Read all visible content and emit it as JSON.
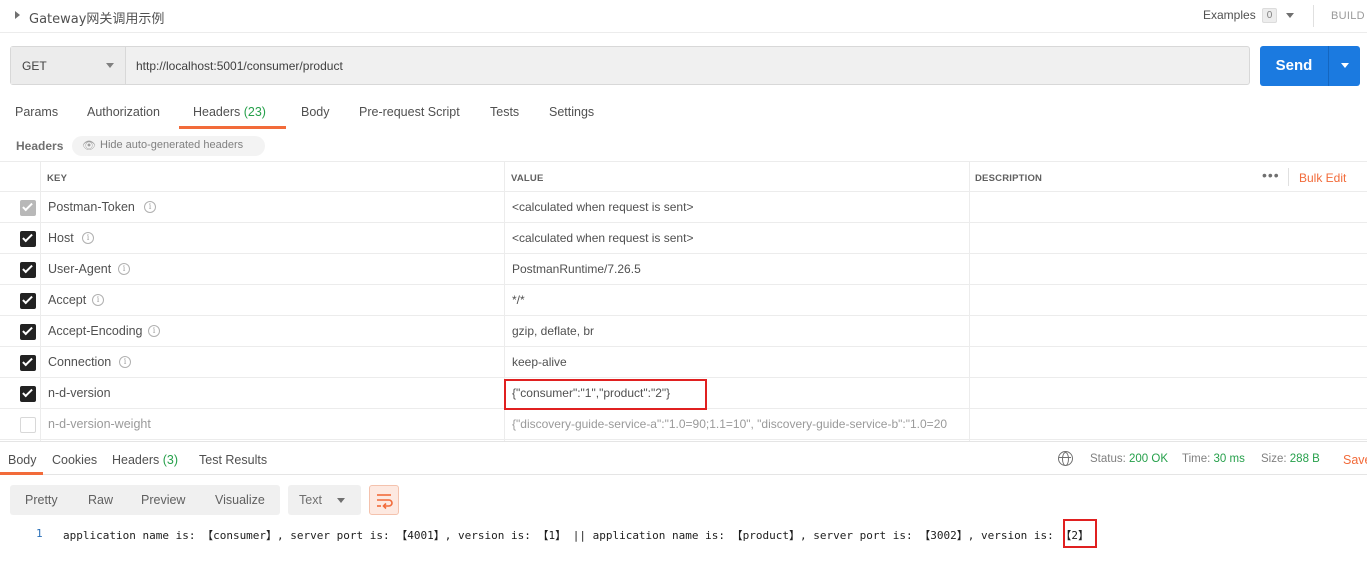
{
  "request": {
    "title": "Gateway网关调用示例",
    "examples_label": "Examples",
    "examples_count": "0",
    "build_label": "BUILD",
    "method": "GET",
    "url": "http://localhost:5001/consumer/product",
    "send_label": "Send"
  },
  "tabs": [
    {
      "label": "Params"
    },
    {
      "label": "Authorization"
    },
    {
      "label": "Headers",
      "count": "(23)",
      "active": true
    },
    {
      "label": "Body"
    },
    {
      "label": "Pre-request Script"
    },
    {
      "label": "Tests"
    },
    {
      "label": "Settings"
    }
  ],
  "headers_toolbar": {
    "label": "Headers",
    "hide_button": "Hide auto-generated headers"
  },
  "table": {
    "columns": [
      "KEY",
      "VALUE",
      "DESCRIPTION"
    ],
    "more_label": "•••",
    "bulk_edit_label": "Bulk Edit",
    "rows": [
      {
        "key": "Postman-Token",
        "value": "<calculated when request is sent>",
        "checked": true,
        "disabled": true,
        "info": true
      },
      {
        "key": "Host",
        "value": "<calculated when request is sent>",
        "checked": true,
        "info": true
      },
      {
        "key": "User-Agent",
        "value": "PostmanRuntime/7.26.5",
        "checked": true,
        "info": true
      },
      {
        "key": "Accept",
        "value": "*/*",
        "checked": true,
        "info": true
      },
      {
        "key": "Accept-Encoding",
        "value": "gzip, deflate, br",
        "checked": true,
        "info": true
      },
      {
        "key": "Connection",
        "value": "keep-alive",
        "checked": true,
        "info": true
      },
      {
        "key": "n-d-version",
        "value": "{\"consumer\":\"1\",\"product\":\"2\"}",
        "checked": true,
        "info": false
      },
      {
        "key": "n-d-version-weight",
        "value": "{\"discovery-guide-service-a\":\"1.0=90;1.1=10\", \"discovery-guide-service-b\":\"1.0=20",
        "checked": false,
        "info": false
      }
    ]
  },
  "response": {
    "tabs": [
      {
        "label": "Body",
        "active": true
      },
      {
        "label": "Cookies"
      },
      {
        "label": "Headers",
        "count": "(3)"
      },
      {
        "label": "Test Results"
      }
    ],
    "status_label": "Status:",
    "status_value": "200 OK",
    "time_label": "Time:",
    "time_value": "30 ms",
    "size_label": "Size:",
    "size_value": "288 B",
    "save_label": "Save",
    "formats": [
      "Pretty",
      "Raw",
      "Preview",
      "Visualize"
    ],
    "text_select": "Text",
    "line_number": "1",
    "body": "application name is: 【consumer】, server port is: 【4001】, version is: 【1】 || application name is: 【product】, server port is: 【3002】, version is: 【2】"
  }
}
